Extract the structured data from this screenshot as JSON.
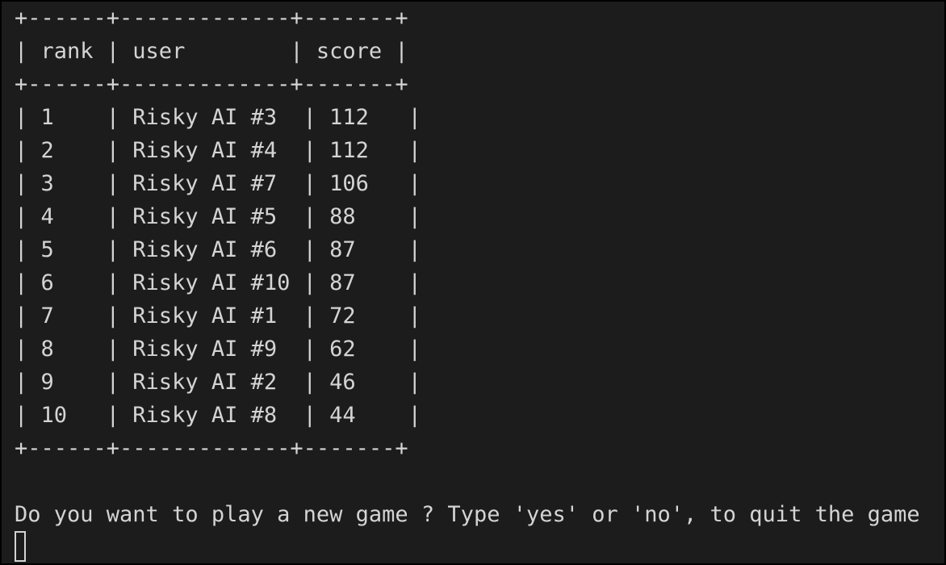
{
  "terminal": {
    "table": {
      "border": "+------+-------------+-------+",
      "header": "| rank | user        | score |",
      "rows": [
        "| 1    | Risky AI #3  | 112   |",
        "| 2    | Risky AI #4  | 112   |",
        "| 3    | Risky AI #7  | 106   |",
        "| 4    | Risky AI #5  | 88    |",
        "| 5    | Risky AI #6  | 87    |",
        "| 6    | Risky AI #10 | 87    |",
        "| 7    | Risky AI #1  | 72    |",
        "| 8    | Risky AI #9  | 62    |",
        "| 9    | Risky AI #2  | 46    |",
        "| 10   | Risky AI #8  | 44    |"
      ]
    },
    "prompt": "Do you want to play a new game ? Type 'yes' or 'no', to quit the game",
    "colors": {
      "background": "#1c1c1c",
      "text": "#d4d4d4",
      "frame": "#000000"
    }
  }
}
